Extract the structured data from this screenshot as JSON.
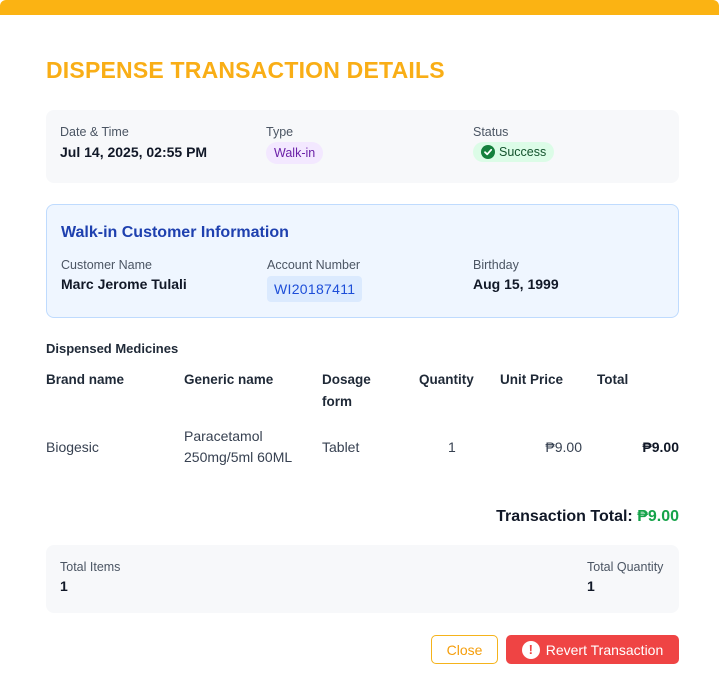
{
  "title": "DISPENSE TRANSACTION DETAILS",
  "transaction": {
    "date_label": "Date & Time",
    "date_value": "Jul 14, 2025, 02:55 PM",
    "type_label": "Type",
    "type_value": "Walk-in",
    "status_label": "Status",
    "status_value": "Success"
  },
  "customer": {
    "section_title": "Walk-in Customer Information",
    "name_label": "Customer Name",
    "name_value": "Marc Jerome Tulali",
    "account_label": "Account Number",
    "account_value": "WI20187411",
    "birthday_label": "Birthday",
    "birthday_value": "Aug 15, 1999"
  },
  "medicines": {
    "section_title": "Dispensed Medicines",
    "columns": [
      "Brand name",
      "Generic name",
      "Dosage",
      "Quantity",
      "Unit Price",
      "Total"
    ],
    "dosage_header_line2": "form",
    "rows": [
      {
        "brand": "Biogesic",
        "generic_line1": "Paracetamol",
        "generic_line2": "250mg/5ml 60ML",
        "dosage_form": "Tablet",
        "quantity": "1",
        "unit_price": "₱9.00",
        "total": "₱9.00"
      }
    ]
  },
  "totals": {
    "transaction_total_label": "Transaction Total:",
    "transaction_total_value": "₱9.00",
    "total_items_label": "Total Items",
    "total_items_value": "1",
    "total_quantity_label": "Total Quantity",
    "total_quantity_value": "1"
  },
  "buttons": {
    "close_label": "Close",
    "revert_label": "Revert Transaction"
  },
  "icons": {
    "status": "check-circle-icon",
    "revert": "alert-circle-icon"
  },
  "colors": {
    "accent": "#f9ae16",
    "success": "#16a34a",
    "danger": "#ef4444",
    "info": "#1e40af"
  }
}
